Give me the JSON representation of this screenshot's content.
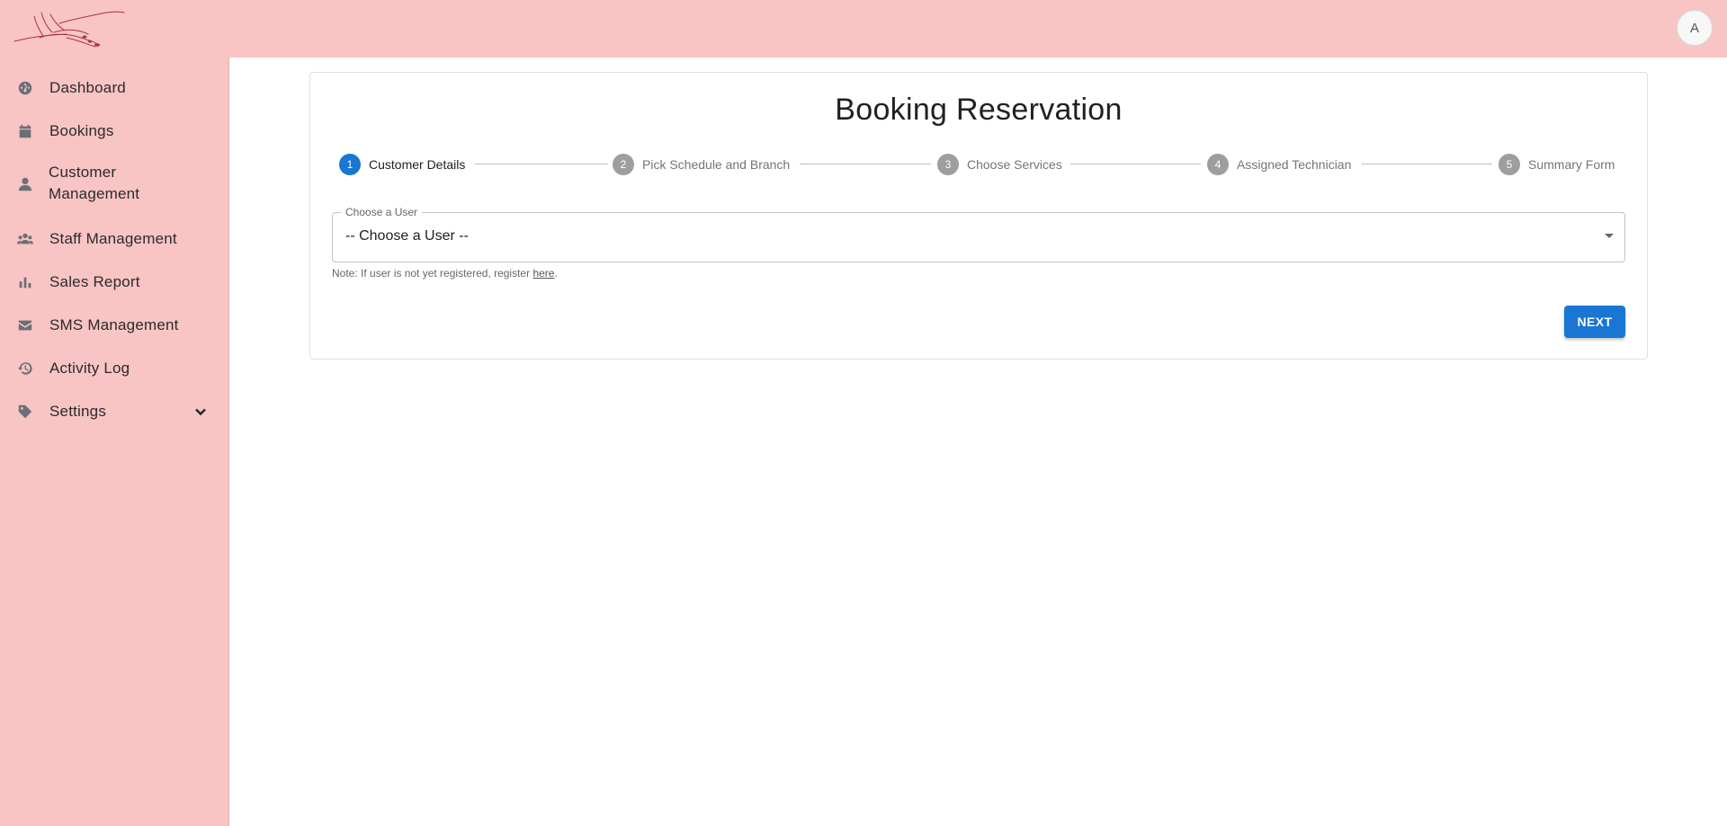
{
  "header": {
    "avatar_initial": "A"
  },
  "sidebar": {
    "items": [
      {
        "label": "Dashboard",
        "icon": "dashboard-icon"
      },
      {
        "label": "Bookings",
        "icon": "calendar-icon"
      },
      {
        "label_line1": "Customer",
        "label_line2": "Management",
        "icon": "user-icon"
      },
      {
        "label": "Staff Management",
        "icon": "users-icon"
      },
      {
        "label": "Sales Report",
        "icon": "bar-chart-icon"
      },
      {
        "label": "SMS Management",
        "icon": "envelope-icon"
      },
      {
        "label": "Activity Log",
        "icon": "history-icon"
      },
      {
        "label": "Settings",
        "icon": "tag-icon"
      }
    ]
  },
  "main": {
    "title": "Booking Reservation",
    "steps": [
      {
        "number": "1",
        "label": "Customer Details",
        "active": true
      },
      {
        "number": "2",
        "label": "Pick Schedule and Branch",
        "active": false
      },
      {
        "number": "3",
        "label": "Choose Services",
        "active": false
      },
      {
        "number": "4",
        "label": "Assigned Technician",
        "active": false
      },
      {
        "number": "5",
        "label": "Summary Form",
        "active": false
      }
    ],
    "user_select": {
      "label": "Choose a User",
      "value": "-- Choose a User --"
    },
    "note": {
      "prefix": "Note: If user is not yet registered, register ",
      "link_text": "here",
      "suffix": "."
    },
    "next_label": "NEXT"
  },
  "colors": {
    "brand_pink": "#f8c4c4",
    "primary": "#1976d2",
    "inactive_step": "#9e9e9e"
  }
}
